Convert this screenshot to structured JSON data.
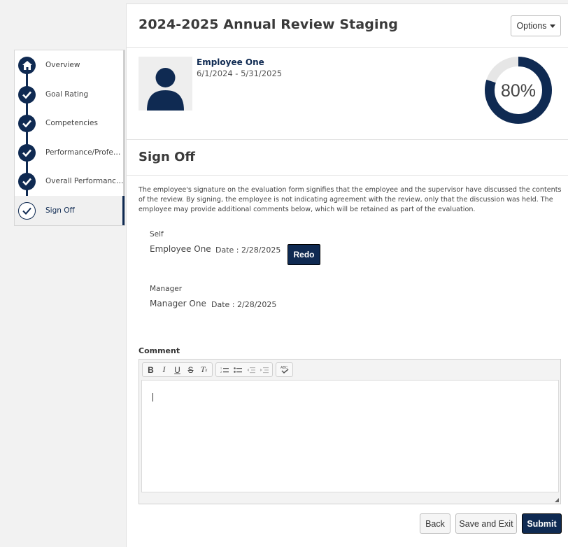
{
  "page": {
    "title": "2024-2025 Annual Review Staging",
    "options_label": "Options"
  },
  "steps": [
    {
      "label": "Overview",
      "icon": "home-icon",
      "status": "complete"
    },
    {
      "label": "Goal Rating",
      "icon": "check-icon",
      "status": "complete"
    },
    {
      "label": "Competencies",
      "icon": "check-icon",
      "status": "complete"
    },
    {
      "label": "Performance/Professi...",
      "icon": "check-icon",
      "status": "complete"
    },
    {
      "label": "Overall Performance R...",
      "icon": "check-icon",
      "status": "complete"
    },
    {
      "label": "Sign Off",
      "icon": "check-icon",
      "status": "active"
    }
  ],
  "employee": {
    "name": "Employee One",
    "period": "6/1/2024 - 5/31/2025",
    "progress_text": "80%",
    "progress": 0.8
  },
  "signoff": {
    "title": "Sign Off",
    "disclaimer": "The employee's signature on the evaluation form signifies that the employee and the supervisor have discussed the contents of the review. By signing, the employee is not indicating agreement with the review, only that the discussion was held. The employee may provide additional comments below, which will be retained as part of the evaluation.",
    "self": {
      "label": "Self",
      "name": "Employee One",
      "date": "Date : 2/28/2025",
      "action": "Redo"
    },
    "manager": {
      "label": "Manager",
      "name": "Manager One",
      "date": "Date : 2/28/2025"
    }
  },
  "comment": {
    "label": "Comment",
    "value": ""
  },
  "actions": {
    "back": "Back",
    "save_exit": "Save and Exit",
    "submit": "Submit"
  },
  "colors": {
    "accent": "#0f2a52",
    "track": "#e6e6e6"
  }
}
